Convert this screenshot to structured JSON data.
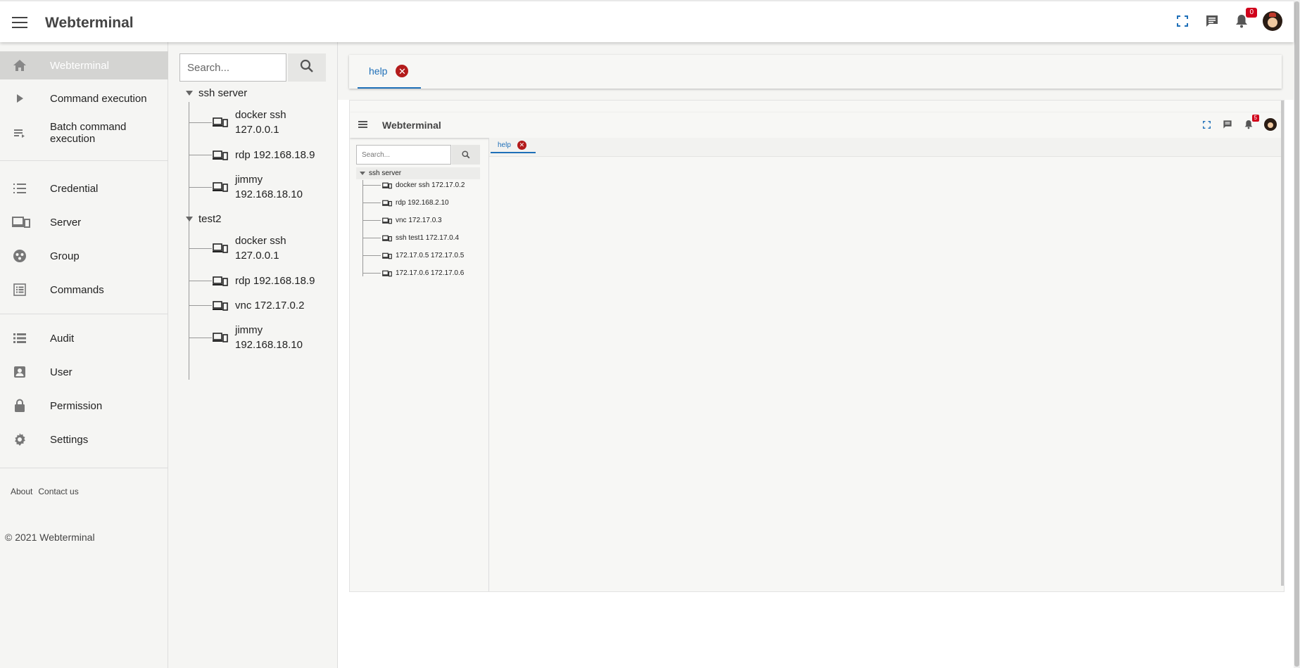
{
  "header": {
    "title": "Webterminal",
    "notification_count": "0",
    "icons": [
      "menu-icon",
      "fullscreen-icon",
      "chat-icon",
      "bell-icon",
      "avatar"
    ]
  },
  "sidebar": {
    "items": [
      {
        "label": "Webterminal",
        "icon": "home-icon",
        "active": true
      },
      {
        "label": "Command execution",
        "icon": "play-icon"
      },
      {
        "label": "Batch command execution",
        "icon": "batch-icon"
      },
      {
        "label": "Credential",
        "icon": "list-icon"
      },
      {
        "label": "Server",
        "icon": "devices-icon"
      },
      {
        "label": "Group",
        "icon": "group-icon"
      },
      {
        "label": "Commands",
        "icon": "commands-icon"
      },
      {
        "label": "Audit",
        "icon": "audit-icon"
      },
      {
        "label": "User",
        "icon": "user-icon"
      },
      {
        "label": "Permission",
        "icon": "lock-icon"
      },
      {
        "label": "Settings",
        "icon": "gear-icon"
      }
    ],
    "footer": {
      "about": "About",
      "contact": "Contact us",
      "copyright": "© 2021 Webterminal"
    }
  },
  "tree": {
    "search_placeholder": "Search...",
    "groups": [
      {
        "name": "ssh server",
        "nodes": [
          {
            "label_line1": "docker ssh",
            "label_line2": "127.0.0.1"
          },
          {
            "label_line1": "rdp 192.168.18.9",
            "label_line2": ""
          },
          {
            "label_line1": "jimmy",
            "label_line2": "192.168.18.10"
          }
        ]
      },
      {
        "name": "test2",
        "nodes": [
          {
            "label_line1": "docker ssh",
            "label_line2": "127.0.0.1"
          },
          {
            "label_line1": "rdp 192.168.18.9",
            "label_line2": ""
          },
          {
            "label_line1": "vnc 172.17.0.2",
            "label_line2": ""
          },
          {
            "label_line1": "jimmy",
            "label_line2": "192.168.18.10"
          }
        ]
      }
    ]
  },
  "main": {
    "tabs": [
      {
        "label": "help",
        "close": "✕"
      }
    ]
  },
  "embedded": {
    "title": "Webterminal",
    "notification_count": "5",
    "search_placeholder": "Search...",
    "group": "ssh server",
    "nodes": [
      "docker ssh 172.17.0.2",
      "rdp 192.168.2.10",
      "vnc 172.17.0.3",
      "ssh test1 172.17.0.4",
      "172.17.0.5 172.17.0.5",
      "172.17.0.6 172.17.0.6"
    ],
    "tab": {
      "label": "help",
      "close": "✕"
    }
  },
  "colors": {
    "accent": "#1e6fb8",
    "badge": "#d0021b",
    "close": "#b31b1b",
    "active_nav": "#d4d4d2"
  }
}
